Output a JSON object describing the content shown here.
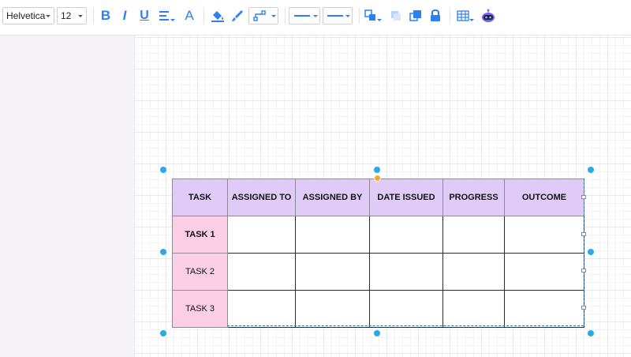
{
  "toolbar": {
    "font_family": "Helvetica",
    "font_size": "12",
    "bold_label": "B",
    "italic_label": "I",
    "underline_label": "U",
    "font_color_label": "A",
    "accent_color": "#2d7ff2"
  },
  "table": {
    "headers": [
      "TASK",
      "ASSIGNED TO",
      "ASSIGNED BY",
      "DATE ISSUED",
      "PROGRESS",
      "OUTCOME"
    ],
    "rows": [
      [
        "TASK 1",
        "",
        "",
        "",
        "",
        ""
      ],
      [
        "TASK 2",
        "",
        "",
        "",
        "",
        ""
      ],
      [
        "TASK 3",
        "",
        "",
        "",
        "",
        ""
      ]
    ],
    "header_color": "#e0cbf8",
    "row_label_color": "#fdcfe7"
  }
}
